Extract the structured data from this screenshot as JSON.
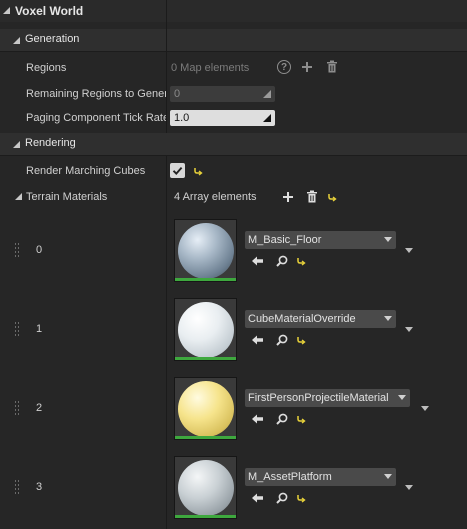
{
  "panel": {
    "title": "Voxel World",
    "generation": {
      "header": "Generation",
      "regions_label": "Regions",
      "regions_value": "0 Map elements",
      "remaining_label": "Remaining Regions to Generate",
      "remaining_value": "0",
      "tick_label": "Paging Component Tick Rate",
      "tick_value": "1.0"
    },
    "rendering": {
      "header": "Rendering",
      "marching_label": "Render Marching Cubes",
      "marching_checked": true,
      "terrain_label": "Terrain Materials",
      "terrain_count": "4 Array elements",
      "materials": [
        {
          "index": "0",
          "name": "M_Basic_Floor"
        },
        {
          "index": "1",
          "name": "CubeMaterialOverride"
        },
        {
          "index": "2",
          "name": "FirstPersonProjectileMaterial"
        },
        {
          "index": "3",
          "name": "M_AssetPlatform"
        }
      ]
    }
  },
  "icons": {
    "help": "help-icon",
    "add": "plus-icon",
    "delete": "trash-icon",
    "reset": "reset-arrow-icon",
    "use_selected": "left-arrow-icon",
    "browse": "magnifier-icon"
  },
  "colors": {
    "background": "#262626",
    "header": "#2f2f2f",
    "accent_green": "#3ea83e",
    "reset_yellow": "#e8d23a"
  }
}
